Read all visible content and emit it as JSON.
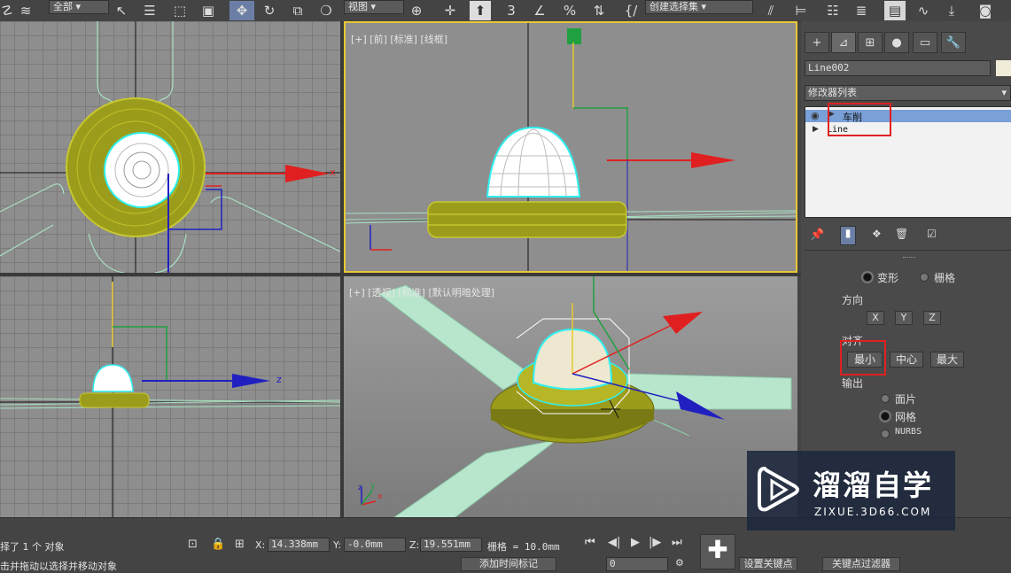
{
  "toolbar": {
    "filter_select": "全部",
    "view_select": "视图",
    "named_selection": "创建选择集"
  },
  "viewports": {
    "top_left_axis": "x",
    "front": {
      "label": "[+] [前] [标准] [线框]"
    },
    "left_axis": "z",
    "perspective": {
      "label": "[+] [透视] [标准] [默认明暗处理]"
    },
    "gizmo_x": "x",
    "gizmo_y": "y",
    "gizmo_z": "z"
  },
  "command_panel": {
    "object_name": "Line002",
    "modifier_list": "修改器列表",
    "stack": [
      {
        "label": "车削",
        "selected": true
      },
      {
        "label": "Line",
        "selected": false
      }
    ],
    "params": {
      "radio_deform": "变形",
      "radio_grid": "栅格",
      "direction_label": "方向",
      "dir_x": "X",
      "dir_y": "Y",
      "dir_z": "Z",
      "align_label": "对齐",
      "align_min": "最小",
      "align_center": "中心",
      "align_max": "最大",
      "output_label": "输出",
      "out_patch": "面片",
      "out_mesh": "网格",
      "out_nurbs": "NURBS"
    }
  },
  "status": {
    "selected_text": "择了 1 个 对象",
    "prompt_text": "击并拖动以选择并移动对象",
    "x_label": "X:",
    "x_value": "14.338mm",
    "y_label": "Y:",
    "y_value": "-0.0mm",
    "z_label": "Z:",
    "z_value": "19.551mm",
    "grid_text": "栅格 = 10.0mm",
    "add_time_tag": "添加时间标记",
    "frame_value": "0",
    "set_key": "设置关键点",
    "key_filter": "关键点过滤器"
  },
  "watermark": {
    "brand": "溜溜自学",
    "url": "ZIXUE.3D66.COM"
  },
  "colors": {
    "selection_highlight": "#e8c832",
    "stack_selected": "#7aa0d8",
    "red_outline": "#e02020",
    "yellow_model": "#bcbc2a",
    "wire_green": "#9ee0b8",
    "cyan_outline": "#30f0f0"
  }
}
